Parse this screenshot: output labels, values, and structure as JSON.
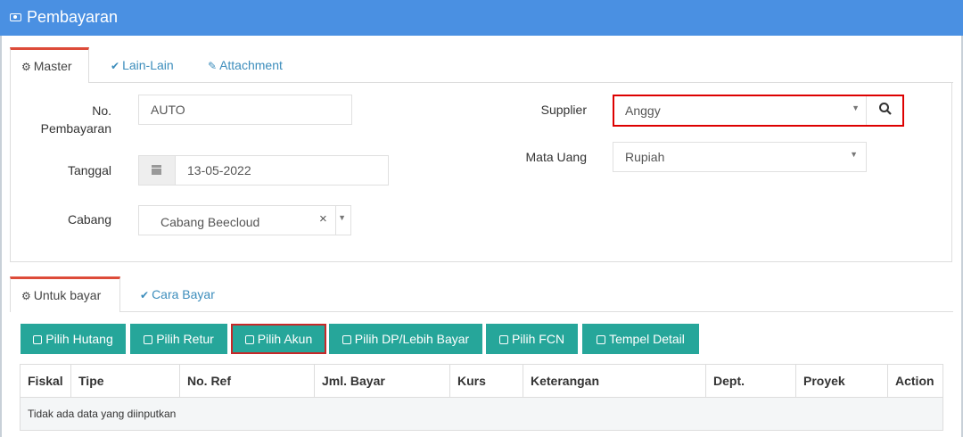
{
  "window": {
    "title": "Pembayaran",
    "icon": "money-icon"
  },
  "top_tabs": [
    {
      "label": "Master",
      "icon": "cogs-icon"
    },
    {
      "label": "Lain-Lain",
      "icon": "check-circle-icon"
    },
    {
      "label": "Attachment",
      "icon": "paperclip-icon"
    }
  ],
  "form": {
    "no_pembayaran": {
      "label_line1": "No.",
      "label_line2": "Pembayaran",
      "value": "AUTO"
    },
    "tanggal": {
      "label": "Tanggal",
      "value": "13-05-2022"
    },
    "cabang": {
      "label": "Cabang",
      "value": "Cabang Beecloud",
      "clear": "×"
    },
    "supplier": {
      "label": "Supplier",
      "value": "Anggy"
    },
    "mata_uang": {
      "label": "Mata Uang",
      "value": "Rupiah"
    }
  },
  "bottom_tabs": [
    {
      "label": "Untuk bayar",
      "icon": "cogs-icon"
    },
    {
      "label": "Cara Bayar",
      "icon": "check-circle-icon"
    }
  ],
  "buttons": [
    {
      "label": "Pilih Hutang"
    },
    {
      "label": "Pilih Retur"
    },
    {
      "label": "Pilih Akun"
    },
    {
      "label": "Pilih DP/Lebih Bayar"
    },
    {
      "label": "Pilih FCN"
    },
    {
      "label": "Tempel Detail"
    }
  ],
  "table": {
    "columns": [
      "Fiskal",
      "Tipe",
      "No. Ref",
      "Jml. Bayar",
      "Kurs",
      "Keterangan",
      "Dept.",
      "Proyek",
      "Action"
    ],
    "empty_message": "Tidak ada data yang diinputkan"
  },
  "colors": {
    "header": "#4a90e2",
    "button": "#26a69a",
    "highlight": "#d00000",
    "tab_active_border": "#dd4b39"
  }
}
